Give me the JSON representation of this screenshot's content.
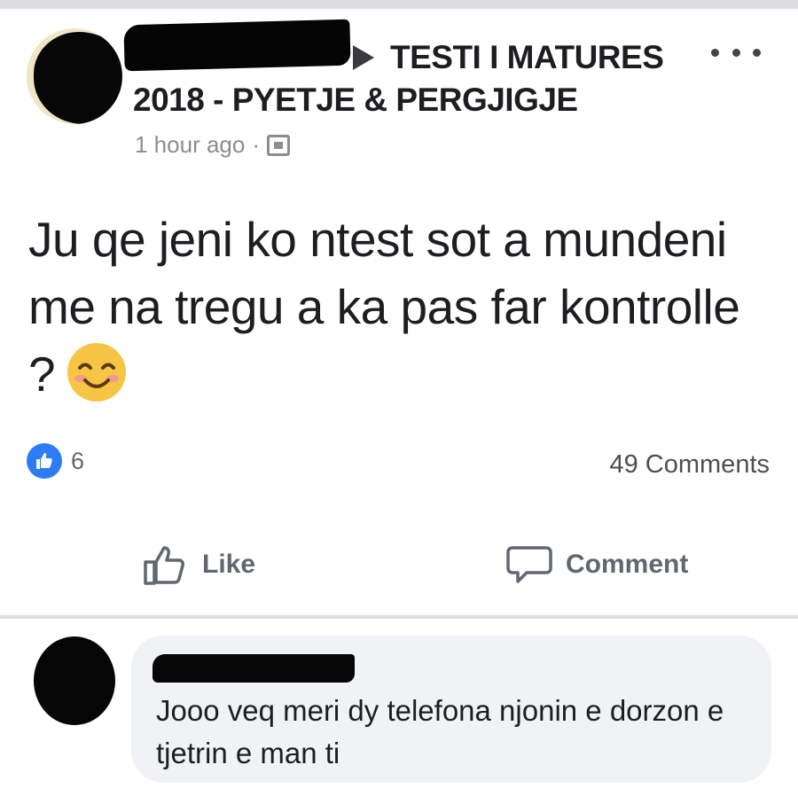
{
  "post": {
    "group_line1": "TESTI I MATURES",
    "group_line2": "2018  - PYETJE & PERGJIGJE",
    "timestamp": "1 hour ago",
    "meta_separator": "·",
    "body": "Ju qe jeni ko ntest sot a mundeni me na tregu a ka pas far kontrolle ?",
    "emoji_icon": "smiling-face-icon",
    "reaction_count": "6",
    "comments_label": "49 Comments",
    "actions": {
      "like": "Like",
      "comment": "Comment"
    }
  },
  "comment": {
    "text": "Jooo veq meri dy telefona njonin e dorzon e tjetrin e man ti"
  },
  "colors": {
    "like_blue": "#2d7cf6",
    "secondary_text": "#606770",
    "bubble_bg": "#f0f2f5"
  }
}
